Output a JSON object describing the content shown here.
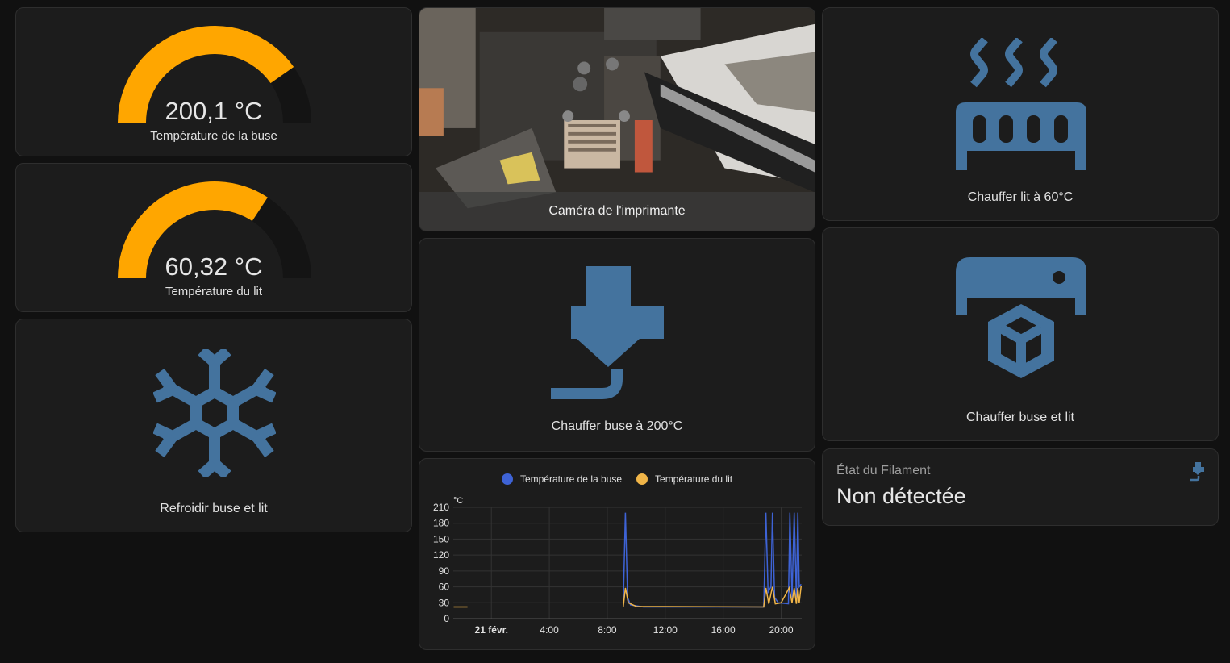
{
  "gauges": [
    {
      "value_text": "200,1 °C",
      "label": "Température de la buse",
      "fraction": 0.805,
      "color": "#ffa600"
    },
    {
      "value_text": "60,32 °C",
      "label": "Température du lit",
      "fraction": 0.685,
      "color": "#ffa600"
    }
  ],
  "buttons": {
    "cool": {
      "label": "Refroidir buse et lit",
      "icon": "snowflake-icon"
    },
    "heat_nozzle": {
      "label": "Chauffer buse à 200°C",
      "icon": "printer-nozzle-icon"
    },
    "heat_bed": {
      "label": "Chauffer lit à 60°C",
      "icon": "radiator-heat-icon"
    },
    "heat_both": {
      "label": "Chauffer buse et lit",
      "icon": "printer-3d-icon"
    }
  },
  "camera": {
    "caption": "Caméra de l'imprimante"
  },
  "filament": {
    "name": "État du Filament",
    "value": "Non détectée",
    "icon": "printer-3d-nozzle-alert-icon"
  },
  "colors": {
    "accent_icon": "#44739e",
    "gauge": "#ffa600",
    "nozzle_series": "#3e63d6",
    "bed_series": "#f0b548"
  },
  "chart_data": {
    "type": "line",
    "unit": "°C",
    "legend_placement": "top",
    "grid": true,
    "ylim": [
      0,
      210
    ],
    "yticks": [
      "210",
      "180",
      "150",
      "120",
      "90",
      "60",
      "30",
      "0"
    ],
    "xlim": [
      "2020-02-20T21:22",
      "2020-02-21T21:25"
    ],
    "xticks": [
      "21 févr.",
      "4:00",
      "8:00",
      "12:00",
      "16:00",
      "20:00"
    ],
    "xtick_hours": [
      0,
      4,
      8,
      12,
      16,
      20
    ],
    "series": [
      {
        "name": "Température de la buse",
        "color": "#3e63d6",
        "points": [
          [
            9.1,
            22
          ],
          [
            9.25,
            200
          ],
          [
            9.4,
            40
          ],
          [
            9.6,
            26
          ],
          [
            10.5,
            22
          ],
          [
            18.8,
            22
          ],
          [
            18.95,
            200
          ],
          [
            19.1,
            50
          ],
          [
            19.3,
            60
          ],
          [
            19.4,
            200
          ],
          [
            19.55,
            40
          ],
          [
            19.8,
            30
          ],
          [
            20.5,
            28
          ],
          [
            20.6,
            200
          ],
          [
            20.75,
            40
          ],
          [
            20.9,
            200
          ],
          [
            21.05,
            40
          ],
          [
            21.15,
            200
          ],
          [
            21.25,
            60
          ],
          [
            21.38,
            65
          ]
        ]
      },
      {
        "name": "Température du lit",
        "color": "#f0b548",
        "points": [
          [
            -2.6,
            22
          ],
          [
            -1.65,
            22
          ],
          [
            9.1,
            22
          ],
          [
            9.25,
            58
          ],
          [
            9.45,
            30
          ],
          [
            10.0,
            23
          ],
          [
            18.8,
            22
          ],
          [
            18.95,
            58
          ],
          [
            19.15,
            28
          ],
          [
            19.4,
            60
          ],
          [
            19.6,
            28
          ],
          [
            20.0,
            30
          ],
          [
            20.55,
            58
          ],
          [
            20.75,
            30
          ],
          [
            20.9,
            58
          ],
          [
            21.05,
            28
          ],
          [
            21.15,
            58
          ],
          [
            21.25,
            30
          ],
          [
            21.38,
            62
          ]
        ]
      }
    ]
  }
}
